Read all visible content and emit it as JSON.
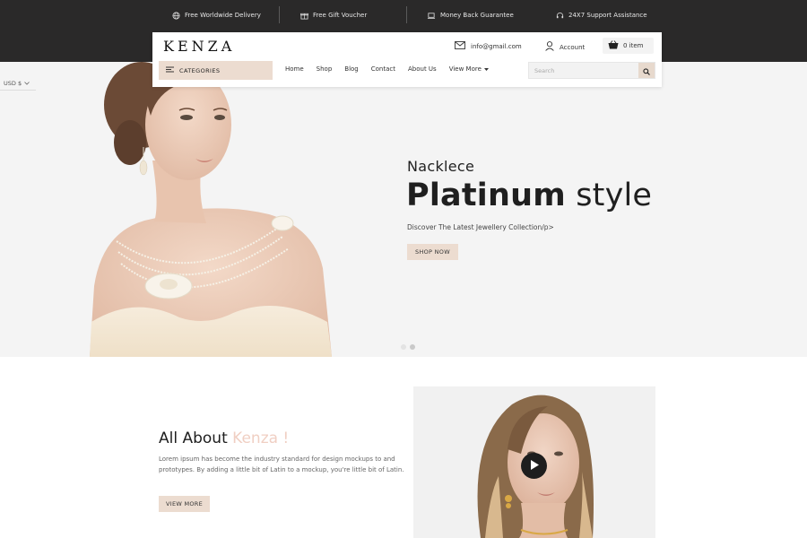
{
  "topbar": {
    "features": [
      {
        "icon": "globe-icon",
        "label": "Free Worldwide Delivery"
      },
      {
        "icon": "gift-icon",
        "label": "Free Gift Voucher"
      },
      {
        "icon": "laptop-icon",
        "label": "Money Back Guarantee"
      },
      {
        "icon": "headset-icon",
        "label": "24X7 Support Assistance"
      }
    ]
  },
  "header": {
    "logo": "KENZA",
    "email": "info@gmail.com",
    "account_label": "Account",
    "cart_label": "0 item",
    "categories_label": "CATEGORIES",
    "nav": [
      {
        "label": "Home"
      },
      {
        "label": "Shop"
      },
      {
        "label": "Blog"
      },
      {
        "label": "Contact"
      },
      {
        "label": "About Us"
      },
      {
        "label": "View More"
      }
    ],
    "search_placeholder": "Search"
  },
  "currency": {
    "label": "USD $"
  },
  "hero": {
    "subtitle": "Nacklece",
    "title_bold": "Platinum",
    "title_light": "style",
    "description": "Discover The Latest Jewellery Collection/p>",
    "button_label": "SHOP NOW",
    "slide_count": 2,
    "active_slide": 2
  },
  "about": {
    "title_main": "All About",
    "title_accent": "Kenza !",
    "text": "Lorem ipsum has become the industry standard for design mockups to and prototypes. By adding a little bit of Latin to a mockup, you're little bit of Latin.",
    "button_label": "VIEW MORE"
  },
  "colors": {
    "topbar_bg": "#2a2929",
    "accent_beige": "#ecdcd0",
    "accent_pink": "#f0cfc3",
    "hero_bg": "#f4f4f4"
  }
}
